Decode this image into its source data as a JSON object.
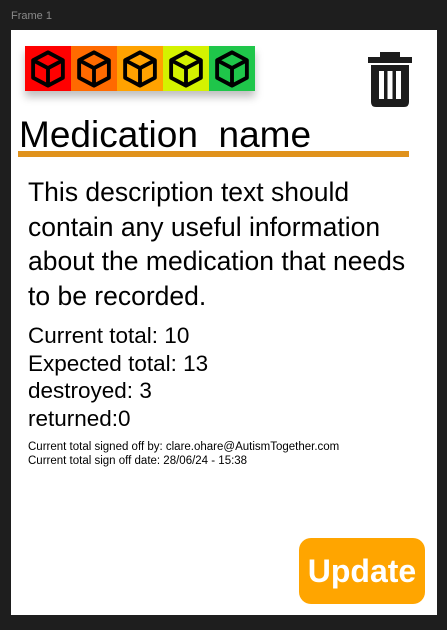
{
  "frame": {
    "label": "Frame 1"
  },
  "rating": {
    "levels": [
      {
        "color": "#ff0000",
        "icon": "cube-icon"
      },
      {
        "color": "#ff6a00",
        "icon": "cube-icon"
      },
      {
        "color": "#ffa200",
        "icon": "cube-icon"
      },
      {
        "color": "#d4f200",
        "icon": "cube-icon"
      },
      {
        "color": "#1fc64a",
        "icon": "cube-icon"
      }
    ]
  },
  "toolbar": {
    "delete_icon": "trash-icon"
  },
  "medication": {
    "name": "Medication_name",
    "accent_color": "#e0921c",
    "description": "This description text should contain any useful information about the medication that needs to be recorded."
  },
  "totals": {
    "current": "Current total: 10",
    "expected": "Expected total: 13",
    "destroyed": "destroyed: 3",
    "returned": "returned:0"
  },
  "signoff": {
    "by": "Current total signed off by: clare.ohare@AutismTogether.com",
    "date": "Current total sign off date: 28/06/24 - 15:38"
  },
  "actions": {
    "update_label": "Update",
    "update_color": "#ffa500"
  }
}
